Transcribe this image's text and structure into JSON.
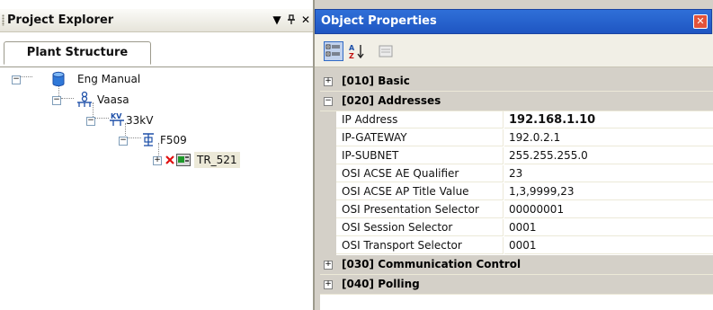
{
  "project_explorer": {
    "title": "Project Explorer",
    "controls": {
      "dropdown": "▼",
      "pin": "ᵖ",
      "close": "✕"
    },
    "tab": "Plant Structure",
    "tree": [
      {
        "label": "Eng Manual",
        "icon": "database-icon"
      },
      {
        "label": "Vaasa",
        "icon": "substation-icon"
      },
      {
        "label": "33kV",
        "icon": "voltage-level-icon"
      },
      {
        "label": "F509",
        "icon": "bay-icon"
      },
      {
        "label": "TR_521",
        "icon": "ied-device-icon"
      }
    ]
  },
  "object_properties": {
    "title": "Object Properties",
    "toolbar": [
      "categorized-icon",
      "alphabetical-sort-icon",
      "property-pages-icon"
    ],
    "categories": [
      {
        "label": "[010] Basic",
        "expanded": false
      },
      {
        "label": "[020] Addresses",
        "expanded": true
      },
      {
        "label": "[030] Communication Control",
        "expanded": false
      },
      {
        "label": "[040] Polling",
        "expanded": false
      }
    ],
    "address_properties": [
      {
        "name": "IP Address",
        "value": "192.168.1.10"
      },
      {
        "name": "IP-GATEWAY",
        "value": "192.0.2.1"
      },
      {
        "name": "IP-SUBNET",
        "value": "255.255.255.0"
      },
      {
        "name": "OSI ACSE AE Qualifier",
        "value": "23"
      },
      {
        "name": "OSI ACSE AP Title Value",
        "value": "1,3,9999,23"
      },
      {
        "name": "OSI Presentation Selector",
        "value": "00000001"
      },
      {
        "name": "OSI Session Selector",
        "value": "0001"
      },
      {
        "name": "OSI Transport Selector",
        "value": "0001"
      }
    ]
  },
  "colors": {
    "titlebar_blue": "#2458c8",
    "close_red": "#e2533a",
    "grid_gray": "#d4d0c8",
    "status_x_red": "#e01010",
    "device_green": "#1e9a2a"
  }
}
